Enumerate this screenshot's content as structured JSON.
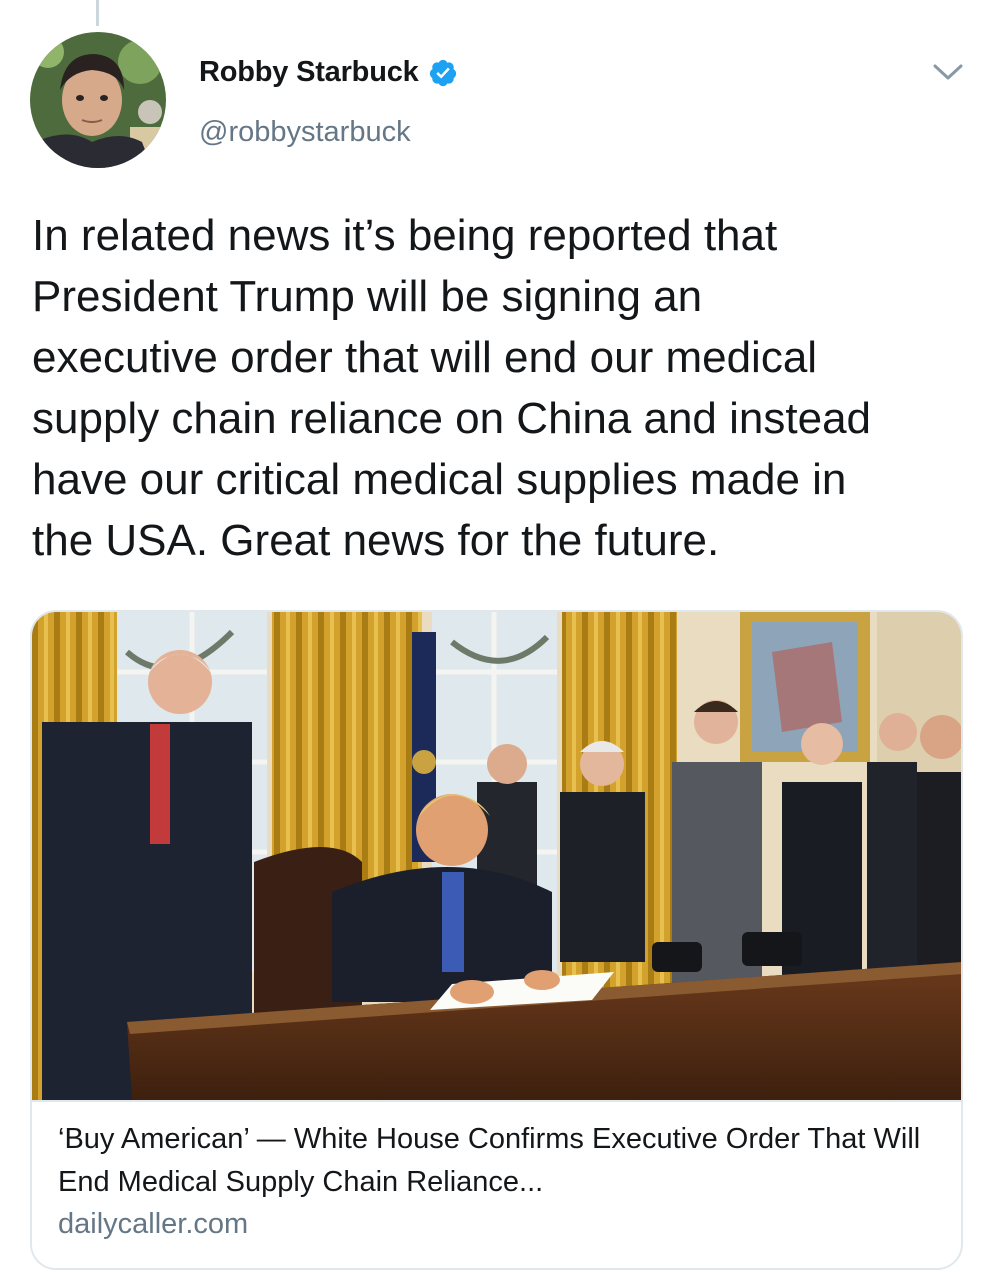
{
  "tweet": {
    "author": {
      "display_name": "Robby Starbuck",
      "handle": "@robbystarbuck",
      "verified": true,
      "avatar_icon": "profile-photo"
    },
    "menu_icon": "chevron-down-icon",
    "text": "In related news it’s being reported that\nPresident Trump will be signing an\nexecutive order that will end our medical\nsupply chain reliance on China and instead\nhave our critical medical supplies made in\nthe USA. Great news for the future.",
    "card": {
      "image_icon": "oval-office-signing-photo",
      "title": "‘Buy American’ — White House Confirms Executive Order That Will End Medical Supply Chain Reliance...",
      "domain": "dailycaller.com"
    }
  },
  "colors": {
    "text_primary": "#14171a",
    "text_secondary": "#657786",
    "verified_blue": "#1da1f2",
    "border": "#e1e8ed",
    "thread_line": "#ccd6dd"
  }
}
